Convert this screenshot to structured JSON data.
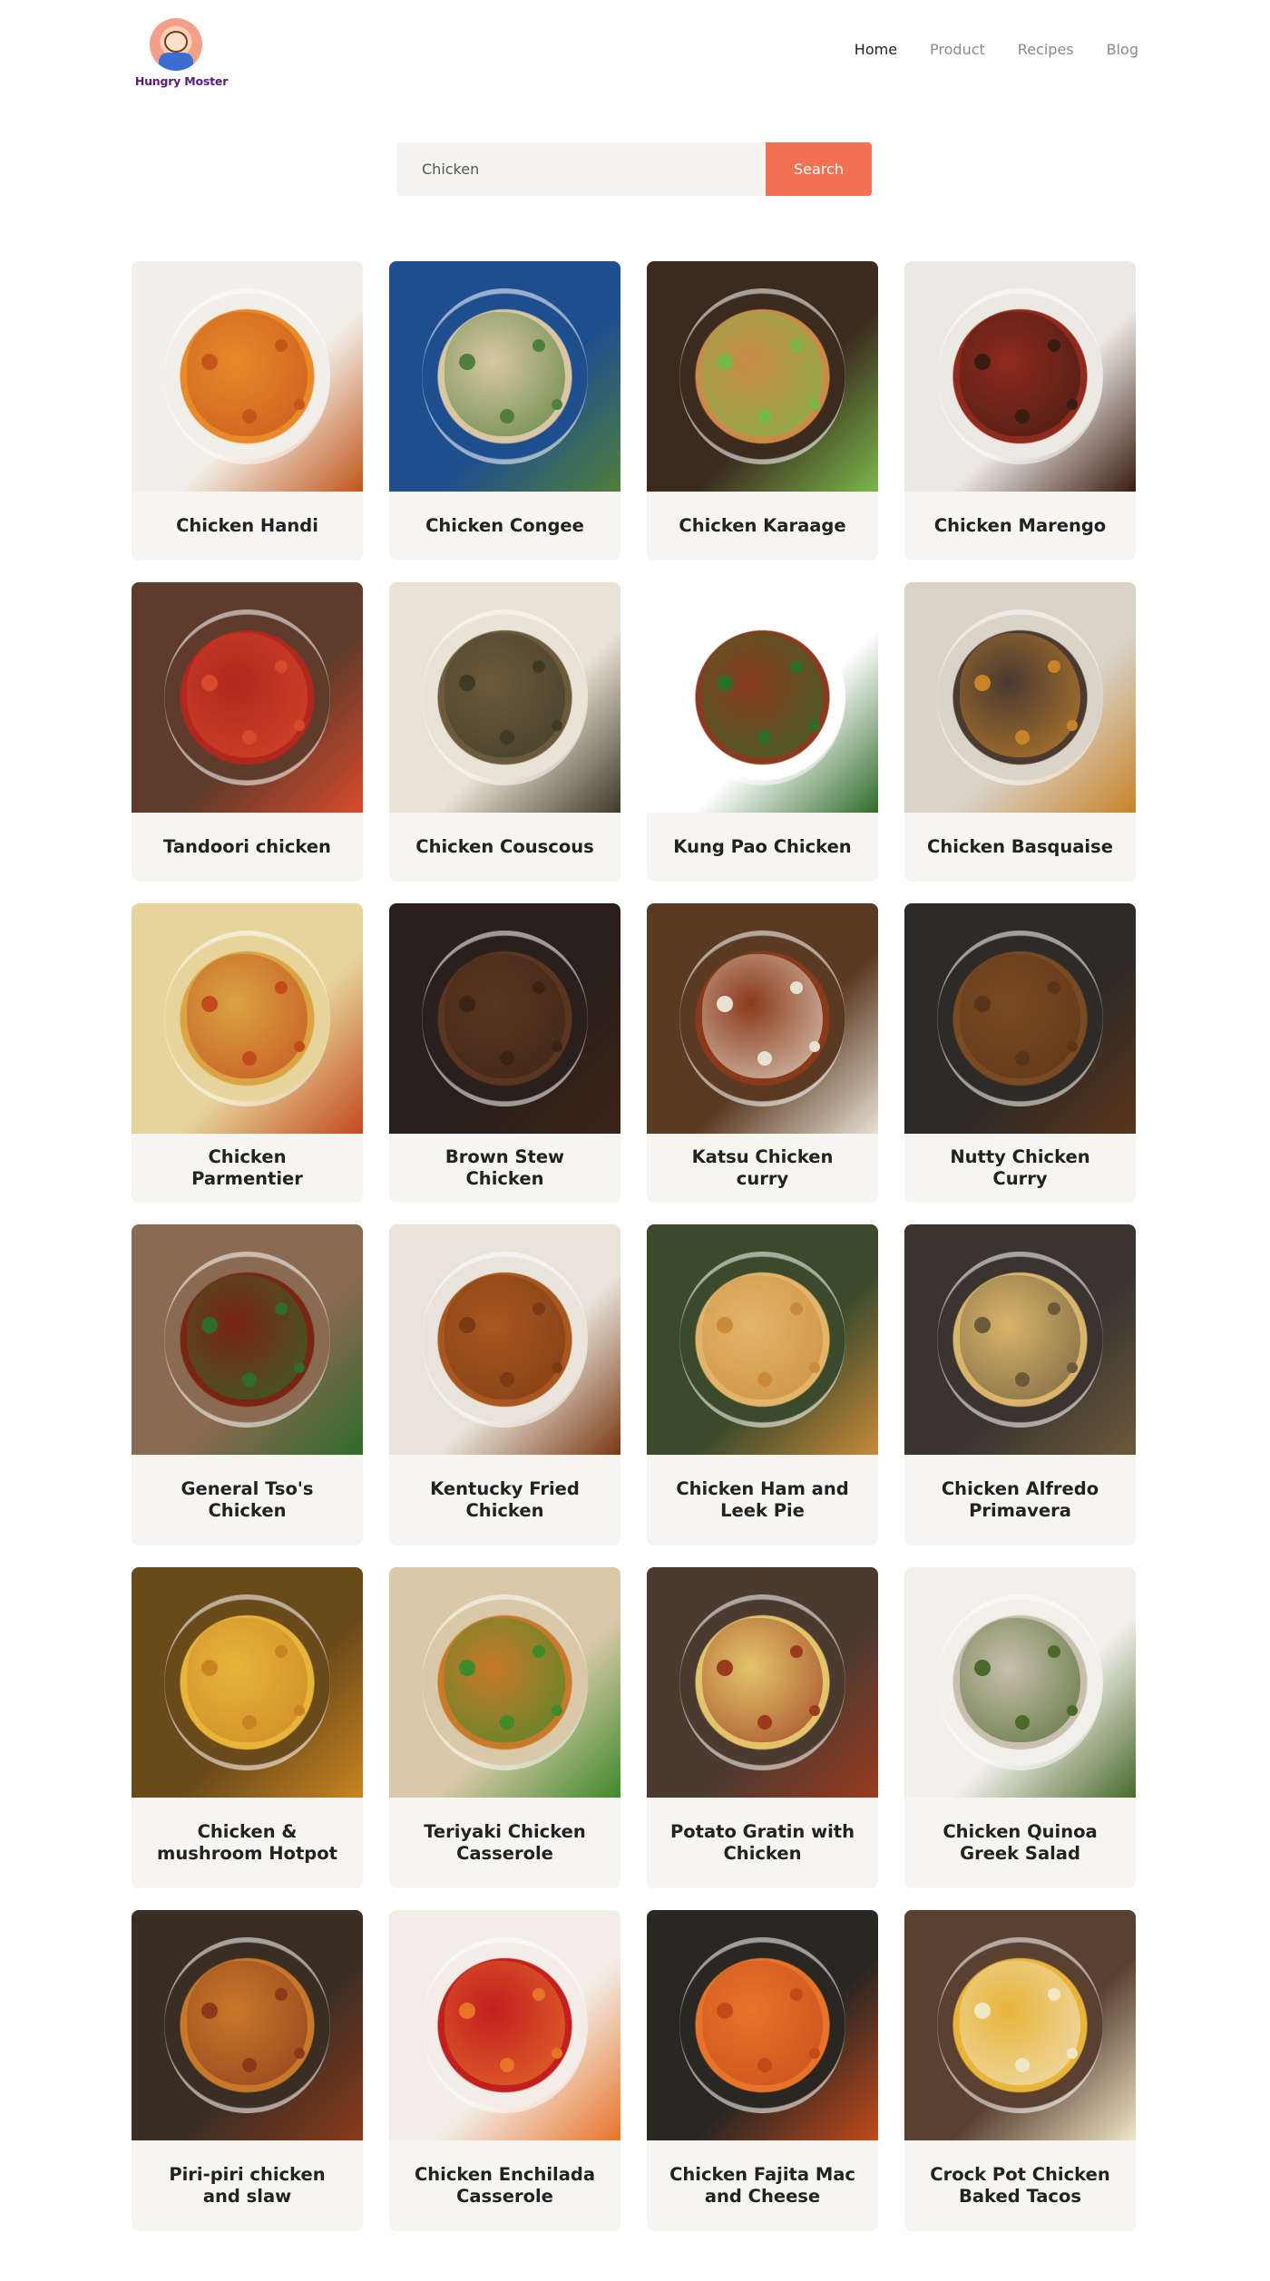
{
  "brand": {
    "name": "Hungry Moster"
  },
  "nav": {
    "items": [
      {
        "label": "Home",
        "active": true
      },
      {
        "label": "Product",
        "active": false
      },
      {
        "label": "Recipes",
        "active": false
      },
      {
        "label": "Blog",
        "active": false
      }
    ]
  },
  "search": {
    "value": "Chicken",
    "button_label": "Search"
  },
  "colors": {
    "accent": "#f27152",
    "card_bg": "#f6f5f2",
    "search_bg": "#f6f4f1"
  },
  "recipes": [
    {
      "title": "Chicken Handi",
      "palette": [
        "#f2efe9",
        "#e8892a",
        "#c2561b"
      ]
    },
    {
      "title": "Chicken Congee",
      "palette": [
        "#1f4e8f",
        "#d9c7a3",
        "#4f7f3a"
      ]
    },
    {
      "title": "Chicken Karaage",
      "palette": [
        "#3b2a1e",
        "#c98a4a",
        "#7ab84a"
      ]
    },
    {
      "title": "Chicken Marengo",
      "palette": [
        "#ece9e2",
        "#8f2a1d",
        "#3a1b12"
      ]
    },
    {
      "title": "Tandoori chicken",
      "palette": [
        "#5e3b2a",
        "#b0281d",
        "#d94a2c"
      ]
    },
    {
      "title": "Chicken Couscous",
      "palette": [
        "#e9e2d6",
        "#6b5a3c",
        "#3f3a26"
      ]
    },
    {
      "title": "Kung Pao Chicken",
      "palette": [
        "#ffffff",
        "#8a3b1f",
        "#2f6b2a"
      ]
    },
    {
      "title": "Chicken Basquaise",
      "palette": [
        "#d9d3c8",
        "#4a3a30",
        "#c9842a"
      ]
    },
    {
      "title": "Chicken Parmentier",
      "palette": [
        "#e7d49a",
        "#d9a441",
        "#c24a1e"
      ]
    },
    {
      "title": "Brown Stew Chicken",
      "palette": [
        "#2a1f1a",
        "#5a3520",
        "#3a2416"
      ]
    },
    {
      "title": "Katsu Chicken curry",
      "palette": [
        "#5a3a22",
        "#8a3a1a",
        "#e8e1d2"
      ]
    },
    {
      "title": "Nutty Chicken Curry",
      "palette": [
        "#2e2a27",
        "#7a4a22",
        "#5a3418"
      ]
    },
    {
      "title": "General Tso's Chicken",
      "palette": [
        "#8a6a50",
        "#7a2412",
        "#2f6b2a"
      ]
    },
    {
      "title": "Kentucky Fried Chicken",
      "palette": [
        "#e9e4da",
        "#a8571f",
        "#7a3a14"
      ]
    },
    {
      "title": "Chicken Ham and Leek Pie",
      "palette": [
        "#3a4a2a",
        "#e3b56a",
        "#c98a3a"
      ]
    },
    {
      "title": "Chicken Alfredo Primavera",
      "palette": [
        "#3a3430",
        "#d9b46a",
        "#6b5a3a"
      ]
    },
    {
      "title": "Chicken & mushroom Hotpot",
      "palette": [
        "#6a4a1a",
        "#e8b43a",
        "#c88420"
      ]
    },
    {
      "title": "Teriyaki Chicken Casserole",
      "palette": [
        "#d9c9a8",
        "#c87a2a",
        "#3f8a2a"
      ]
    },
    {
      "title": "Potato Gratin with Chicken",
      "palette": [
        "#4a3a30",
        "#e3c46a",
        "#9a3a1e"
      ]
    },
    {
      "title": "Chicken Quinoa Greek Salad",
      "palette": [
        "#f2f0ea",
        "#c9bfae",
        "#4a6a2a"
      ]
    },
    {
      "title": "Piri-piri chicken and slaw",
      "palette": [
        "#3a2e24",
        "#c9782a",
        "#8a3a1a"
      ]
    },
    {
      "title": "Chicken Enchilada Casserole",
      "palette": [
        "#f2ede6",
        "#c21f1f",
        "#e8742a"
      ]
    },
    {
      "title": "Chicken Fajita Mac and Cheese",
      "palette": [
        "#2a2622",
        "#e8742a",
        "#c24a1a"
      ]
    },
    {
      "title": "Crock Pot Chicken Baked Tacos",
      "palette": [
        "#5a4030",
        "#e8b43a",
        "#f0e6c8"
      ]
    }
  ]
}
